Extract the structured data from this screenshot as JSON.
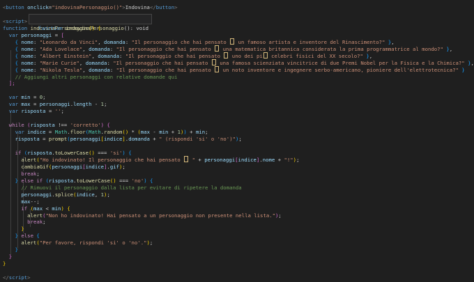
{
  "hover": {
    "kw": "function",
    "name": "indovinaPersonaggio",
    "sig": "(): void"
  },
  "lines": [
    [
      [
        "#808080",
        "<"
      ],
      [
        "#569cd6",
        "button"
      ],
      [
        "#9cdcfe",
        " onclick"
      ],
      [
        "#d4d4d4",
        "="
      ],
      [
        "#ce9178",
        "\"indovinaPersonaggio()\""
      ],
      [
        "#808080",
        ">"
      ],
      [
        "#d4d4d4",
        "Indovina"
      ],
      [
        "#808080",
        "</"
      ],
      [
        "#569cd6",
        "button"
      ],
      [
        "#808080",
        ">"
      ]
    ],
    [],
    [
      [
        "#808080",
        "<"
      ],
      [
        "#569cd6",
        "script"
      ],
      [
        "#808080",
        ">"
      ]
    ],
    [
      [
        "#569cd6",
        "function"
      ],
      [
        "#d4d4d4",
        " "
      ],
      [
        "#dcdcaa",
        "indovinaPersonaggio"
      ],
      [
        "#ffd700",
        "()"
      ],
      [
        "#d4d4d4",
        " "
      ],
      [
        "#ffd700",
        "{"
      ]
    ],
    [
      [
        "#d4d4d4",
        "  "
      ],
      [
        "#569cd6",
        "var"
      ],
      [
        "#d4d4d4",
        " "
      ],
      [
        "#9cdcfe",
        "personaggi"
      ],
      [
        "#d4d4d4",
        " = "
      ],
      [
        "#da70d6",
        "["
      ]
    ],
    [
      [
        "#d4d4d4",
        "    "
      ],
      [
        "#179fff",
        "{"
      ],
      [
        "#d4d4d4",
        " "
      ],
      [
        "#9cdcfe",
        "nome"
      ],
      [
        "#d4d4d4",
        ": "
      ],
      [
        "#ce9178",
        "\"Leonardo da Vinci\""
      ],
      [
        "#d4d4d4",
        ", "
      ],
      [
        "#9cdcfe",
        "domanda"
      ],
      [
        "#d4d4d4",
        ": "
      ],
      [
        "#ce9178",
        "\"Il personaggio che hai pensato "
      ],
      [
        "HL",
        ""
      ],
      [
        "#ce9178",
        " un famoso artista e inventore del Rinascimento?\""
      ],
      [
        "#d4d4d4",
        " "
      ],
      [
        "#179fff",
        "}"
      ],
      [
        "#d4d4d4",
        ","
      ]
    ],
    [
      [
        "#d4d4d4",
        "    "
      ],
      [
        "#179fff",
        "{"
      ],
      [
        "#d4d4d4",
        " "
      ],
      [
        "#9cdcfe",
        "nome"
      ],
      [
        "#d4d4d4",
        ": "
      ],
      [
        "#ce9178",
        "\"Ada Lovelace\""
      ],
      [
        "#d4d4d4",
        ", "
      ],
      [
        "#9cdcfe",
        "domanda"
      ],
      [
        "#d4d4d4",
        ": "
      ],
      [
        "#ce9178",
        "\"Il personaggio che hai pensato "
      ],
      [
        "HL",
        ""
      ],
      [
        "#ce9178",
        " una matematica britannica considerata la prima programmatrice al mondo?\""
      ],
      [
        "#d4d4d4",
        " "
      ],
      [
        "#179fff",
        "}"
      ],
      [
        "#d4d4d4",
        ","
      ]
    ],
    [
      [
        "#d4d4d4",
        "    "
      ],
      [
        "#179fff",
        "{"
      ],
      [
        "#d4d4d4",
        " "
      ],
      [
        "#9cdcfe",
        "nome"
      ],
      [
        "#d4d4d4",
        ": "
      ],
      [
        "#ce9178",
        "\"Albert Einstein\""
      ],
      [
        "#d4d4d4",
        ", "
      ],
      [
        "#9cdcfe",
        "domanda"
      ],
      [
        "#d4d4d4",
        ": "
      ],
      [
        "#ce9178",
        "\"Il personaggio che hai pensato "
      ],
      [
        "HL",
        ""
      ],
      [
        "#ce9178",
        " uno dei pi"
      ],
      [
        "HL",
        ""
      ],
      [
        "#ce9178",
        " celebri fisici del XX secolo?\""
      ],
      [
        "#d4d4d4",
        " "
      ],
      [
        "#179fff",
        "}"
      ],
      [
        "#d4d4d4",
        ","
      ]
    ],
    [
      [
        "#d4d4d4",
        "    "
      ],
      [
        "#179fff",
        "{"
      ],
      [
        "#d4d4d4",
        " "
      ],
      [
        "#9cdcfe",
        "nome"
      ],
      [
        "#d4d4d4",
        ": "
      ],
      [
        "#ce9178",
        "\"Marie Curie\""
      ],
      [
        "#d4d4d4",
        ", "
      ],
      [
        "#9cdcfe",
        "domanda"
      ],
      [
        "#d4d4d4",
        ": "
      ],
      [
        "#ce9178",
        "\"Il personaggio che hai pensato "
      ],
      [
        "HL",
        ""
      ],
      [
        "#ce9178",
        " una famosa scienziata vincitrice di due Premi Nobel per la Fisica e la Chimica?\""
      ],
      [
        "#d4d4d4",
        " "
      ],
      [
        "#179fff",
        "}"
      ],
      [
        "#d4d4d4",
        ","
      ]
    ],
    [
      [
        "#d4d4d4",
        "    "
      ],
      [
        "#179fff",
        "{"
      ],
      [
        "#d4d4d4",
        " "
      ],
      [
        "#9cdcfe",
        "nome"
      ],
      [
        "#d4d4d4",
        ": "
      ],
      [
        "#ce9178",
        "\"Nikola Tesla\""
      ],
      [
        "#d4d4d4",
        ", "
      ],
      [
        "#9cdcfe",
        "domanda"
      ],
      [
        "#d4d4d4",
        ": "
      ],
      [
        "#ce9178",
        "\"Il personaggio che hai pensato "
      ],
      [
        "HL",
        ""
      ],
      [
        "#ce9178",
        " un noto inventore e ingegnere serbo-americano, pioniere dell'elettrotecnica?\""
      ],
      [
        "#d4d4d4",
        " "
      ],
      [
        "#179fff",
        "}"
      ]
    ],
    [
      [
        "#d4d4d4",
        "    "
      ],
      [
        "#6a9955",
        "// Aggiungi altri personaggi con relative domande qui"
      ]
    ],
    [
      [
        "#d4d4d4",
        "  "
      ],
      [
        "#da70d6",
        "];"
      ]
    ],
    [],
    [
      [
        "#d4d4d4",
        "  "
      ],
      [
        "#569cd6",
        "var"
      ],
      [
        "#d4d4d4",
        " "
      ],
      [
        "#9cdcfe",
        "min"
      ],
      [
        "#d4d4d4",
        " = "
      ],
      [
        "#b5cea8",
        "0"
      ],
      [
        "#d4d4d4",
        ";"
      ]
    ],
    [
      [
        "#d4d4d4",
        "  "
      ],
      [
        "#569cd6",
        "var"
      ],
      [
        "#d4d4d4",
        " "
      ],
      [
        "#9cdcfe",
        "max"
      ],
      [
        "#d4d4d4",
        " = "
      ],
      [
        "#9cdcfe",
        "personaggi"
      ],
      [
        "#d4d4d4",
        "."
      ],
      [
        "#9cdcfe",
        "length"
      ],
      [
        "#d4d4d4",
        " - "
      ],
      [
        "#b5cea8",
        "1"
      ],
      [
        "#d4d4d4",
        ";"
      ]
    ],
    [
      [
        "#d4d4d4",
        "  "
      ],
      [
        "#569cd6",
        "var"
      ],
      [
        "#d4d4d4",
        " "
      ],
      [
        "#9cdcfe",
        "risposta"
      ],
      [
        "#d4d4d4",
        " = "
      ],
      [
        "#ce9178",
        "''"
      ],
      [
        "#d4d4d4",
        ";"
      ]
    ],
    [],
    [
      [
        "#d4d4d4",
        "  "
      ],
      [
        "#c586c0",
        "while"
      ],
      [
        "#d4d4d4",
        " "
      ],
      [
        "#da70d6",
        "("
      ],
      [
        "#9cdcfe",
        "risposta"
      ],
      [
        "#d4d4d4",
        " !== "
      ],
      [
        "#ce9178",
        "'corretto'"
      ],
      [
        "#da70d6",
        ")"
      ],
      [
        "#d4d4d4",
        " "
      ],
      [
        "#da70d6",
        "{"
      ]
    ],
    [
      [
        "#d4d4d4",
        "    "
      ],
      [
        "#569cd6",
        "var"
      ],
      [
        "#d4d4d4",
        " "
      ],
      [
        "#9cdcfe",
        "indice"
      ],
      [
        "#d4d4d4",
        " = "
      ],
      [
        "#4ec9b0",
        "Math"
      ],
      [
        "#d4d4d4",
        "."
      ],
      [
        "#dcdcaa",
        "floor"
      ],
      [
        "#179fff",
        "("
      ],
      [
        "#4ec9b0",
        "Math"
      ],
      [
        "#d4d4d4",
        "."
      ],
      [
        "#dcdcaa",
        "random"
      ],
      [
        "#ffd700",
        "()"
      ],
      [
        "#d4d4d4",
        " * "
      ],
      [
        "#ffd700",
        "("
      ],
      [
        "#9cdcfe",
        "max"
      ],
      [
        "#d4d4d4",
        " - "
      ],
      [
        "#9cdcfe",
        "min"
      ],
      [
        "#d4d4d4",
        " + "
      ],
      [
        "#b5cea8",
        "1"
      ],
      [
        "#ffd700",
        ")"
      ],
      [
        "#179fff",
        ")"
      ],
      [
        "#d4d4d4",
        " + "
      ],
      [
        "#9cdcfe",
        "min"
      ],
      [
        "#d4d4d4",
        ";"
      ]
    ],
    [
      [
        "#d4d4d4",
        "    "
      ],
      [
        "#9cdcfe",
        "risposta"
      ],
      [
        "#d4d4d4",
        " = "
      ],
      [
        "#dcdcaa",
        "prompt"
      ],
      [
        "#179fff",
        "("
      ],
      [
        "#9cdcfe",
        "personaggi"
      ],
      [
        "#ffd700",
        "["
      ],
      [
        "#9cdcfe",
        "indice"
      ],
      [
        "#ffd700",
        "]"
      ],
      [
        "#d4d4d4",
        "."
      ],
      [
        "#9cdcfe",
        "domanda"
      ],
      [
        "#d4d4d4",
        " + "
      ],
      [
        "#ce9178",
        "\" (rispondi 'si' o 'no')\""
      ],
      [
        "#179fff",
        ")"
      ],
      [
        "#d4d4d4",
        ";"
      ]
    ],
    [],
    [
      [
        "#d4d4d4",
        "    "
      ],
      [
        "#c586c0",
        "if"
      ],
      [
        "#d4d4d4",
        " "
      ],
      [
        "#179fff",
        "("
      ],
      [
        "#9cdcfe",
        "risposta"
      ],
      [
        "#d4d4d4",
        "."
      ],
      [
        "#dcdcaa",
        "toLowerCase"
      ],
      [
        "#ffd700",
        "()"
      ],
      [
        "#d4d4d4",
        " === "
      ],
      [
        "#ce9178",
        "'si'"
      ],
      [
        "#179fff",
        ")"
      ],
      [
        "#d4d4d4",
        " "
      ],
      [
        "#179fff",
        "{"
      ]
    ],
    [
      [
        "#d4d4d4",
        "      "
      ],
      [
        "#dcdcaa",
        "alert"
      ],
      [
        "#ffd700",
        "("
      ],
      [
        "#ce9178",
        "\"Ho indovinato! Il personaggio che hai pensato "
      ],
      [
        "HL",
        ""
      ],
      [
        "#ce9178",
        " \""
      ],
      [
        "#d4d4d4",
        " + "
      ],
      [
        "#9cdcfe",
        "personaggi"
      ],
      [
        "#da70d6",
        "["
      ],
      [
        "#9cdcfe",
        "indice"
      ],
      [
        "#da70d6",
        "]"
      ],
      [
        "#d4d4d4",
        "."
      ],
      [
        "#9cdcfe",
        "nome"
      ],
      [
        "#d4d4d4",
        " + "
      ],
      [
        "#ce9178",
        "\"!\""
      ],
      [
        "#ffd700",
        ")"
      ],
      [
        "#d4d4d4",
        ";"
      ]
    ],
    [
      [
        "#d4d4d4",
        "      "
      ],
      [
        "#dcdcaa",
        "cambiaGif"
      ],
      [
        "#ffd700",
        "("
      ],
      [
        "#9cdcfe",
        "personaggi"
      ],
      [
        "#da70d6",
        "["
      ],
      [
        "#9cdcfe",
        "indice"
      ],
      [
        "#da70d6",
        "]"
      ],
      [
        "#d4d4d4",
        "."
      ],
      [
        "#9cdcfe",
        "gif"
      ],
      [
        "#ffd700",
        ")"
      ],
      [
        "#d4d4d4",
        ";"
      ]
    ],
    [
      [
        "#d4d4d4",
        "      "
      ],
      [
        "#c586c0",
        "break"
      ],
      [
        "#d4d4d4",
        ";"
      ]
    ],
    [
      [
        "#d4d4d4",
        "    "
      ],
      [
        "#179fff",
        "}"
      ],
      [
        "#d4d4d4",
        " "
      ],
      [
        "#c586c0",
        "else"
      ],
      [
        "#d4d4d4",
        " "
      ],
      [
        "#c586c0",
        "if"
      ],
      [
        "#d4d4d4",
        " "
      ],
      [
        "#179fff",
        "("
      ],
      [
        "#9cdcfe",
        "risposta"
      ],
      [
        "#d4d4d4",
        "."
      ],
      [
        "#dcdcaa",
        "toLowerCase"
      ],
      [
        "#ffd700",
        "()"
      ],
      [
        "#d4d4d4",
        " === "
      ],
      [
        "#ce9178",
        "'no'"
      ],
      [
        "#179fff",
        ")"
      ],
      [
        "#d4d4d4",
        " "
      ],
      [
        "#179fff",
        "{"
      ]
    ],
    [
      [
        "#d4d4d4",
        "      "
      ],
      [
        "#6a9955",
        "// Rimuovi il personaggio dalla lista per evitare di ripetere la domanda"
      ]
    ],
    [
      [
        "#d4d4d4",
        "      "
      ],
      [
        "#9cdcfe",
        "personaggi"
      ],
      [
        "#d4d4d4",
        "."
      ],
      [
        "#dcdcaa",
        "splice"
      ],
      [
        "#ffd700",
        "("
      ],
      [
        "#9cdcfe",
        "indice"
      ],
      [
        "#d4d4d4",
        ", "
      ],
      [
        "#b5cea8",
        "1"
      ],
      [
        "#ffd700",
        ")"
      ],
      [
        "#d4d4d4",
        ";"
      ]
    ],
    [
      [
        "#d4d4d4",
        "      "
      ],
      [
        "#9cdcfe",
        "max"
      ],
      [
        "#d4d4d4",
        "--;"
      ]
    ],
    [
      [
        "#d4d4d4",
        "      "
      ],
      [
        "#c586c0",
        "if"
      ],
      [
        "#d4d4d4",
        " "
      ],
      [
        "#ffd700",
        "("
      ],
      [
        "#9cdcfe",
        "max"
      ],
      [
        "#d4d4d4",
        " < "
      ],
      [
        "#9cdcfe",
        "min"
      ],
      [
        "#ffd700",
        ")"
      ],
      [
        "#d4d4d4",
        " "
      ],
      [
        "#ffd700",
        "{"
      ]
    ],
    [
      [
        "#d4d4d4",
        "        "
      ],
      [
        "#dcdcaa",
        "alert"
      ],
      [
        "#da70d6",
        "("
      ],
      [
        "#ce9178",
        "\"Non ho indovinato! Hai pensato a un personaggio non presente nella lista.\""
      ],
      [
        "#da70d6",
        ")"
      ],
      [
        "#d4d4d4",
        ";"
      ]
    ],
    [
      [
        "#d4d4d4",
        "        "
      ],
      [
        "#c586c0",
        "break"
      ],
      [
        "#d4d4d4",
        ";"
      ]
    ],
    [
      [
        "#d4d4d4",
        "      "
      ],
      [
        "#ffd700",
        "}"
      ]
    ],
    [
      [
        "#d4d4d4",
        "    "
      ],
      [
        "#179fff",
        "}"
      ],
      [
        "#d4d4d4",
        " "
      ],
      [
        "#c586c0",
        "else"
      ],
      [
        "#d4d4d4",
        " "
      ],
      [
        "#179fff",
        "{"
      ]
    ],
    [
      [
        "#d4d4d4",
        "      "
      ],
      [
        "#dcdcaa",
        "alert"
      ],
      [
        "#ffd700",
        "("
      ],
      [
        "#ce9178",
        "\"Per favore, rispondi 'si' o 'no'.\""
      ],
      [
        "#ffd700",
        ")"
      ],
      [
        "#d4d4d4",
        ";"
      ]
    ],
    [
      [
        "#d4d4d4",
        "    "
      ],
      [
        "#179fff",
        "}"
      ]
    ],
    [
      [
        "#d4d4d4",
        "  "
      ],
      [
        "#da70d6",
        "}"
      ]
    ],
    [
      [
        "#ffd700",
        "}"
      ]
    ],
    [],
    [
      [
        "#808080",
        "</"
      ],
      [
        "#569cd6",
        "script"
      ],
      [
        "#808080",
        ">"
      ]
    ]
  ]
}
